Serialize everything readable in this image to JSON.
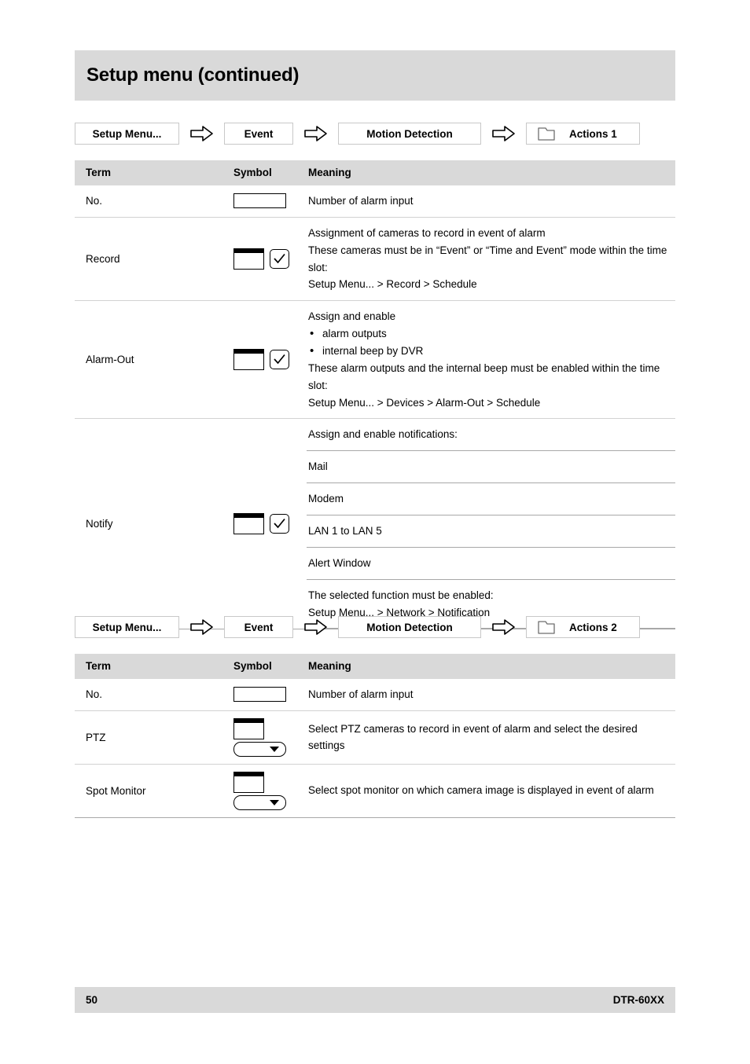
{
  "header": {
    "title": "Setup menu (continued)"
  },
  "breadcrumbs": [
    {
      "name": "actions-1",
      "items": [
        "Setup Menu...",
        "Event",
        "Motion Detection",
        "Actions 1"
      ],
      "arrow_icon": "right-arrow-icon",
      "folder_icon": "folder-tab-icon"
    },
    {
      "name": "actions-2",
      "items": [
        "Setup Menu...",
        "Event",
        "Motion Detection",
        "Actions 2"
      ],
      "arrow_icon": "right-arrow-icon",
      "folder_icon": "folder-tab-icon"
    }
  ],
  "table1": {
    "headers": [
      "Term",
      "Symbol",
      "Meaning"
    ],
    "rows": [
      {
        "term": "No.",
        "symbols": [
          "text-field-icon"
        ],
        "meaning_lines": [
          "Number of alarm input"
        ]
      },
      {
        "term": "Record",
        "symbols": [
          "window-icon",
          "checkbox-checked-icon"
        ],
        "meaning_lines": [
          "Assignment of cameras to record in event of alarm",
          "These cameras must be in “Event” or “Time and Event” mode within the time slot:",
          "Setup Menu... > Record > Schedule"
        ]
      },
      {
        "term": "Alarm-Out",
        "symbols": [
          "window-icon",
          "checkbox-checked-icon"
        ],
        "meaning_lines": [
          "Assign and enable"
        ],
        "bullets": [
          "alarm outputs",
          "internal beep by DVR"
        ],
        "meaning_lines_after": [
          "These alarm outputs and the internal beep must be enabled within the time slot:",
          "Setup Menu... > Devices > Alarm-Out > Schedule"
        ]
      },
      {
        "term": "Notify",
        "symbols": [
          "window-icon",
          "checkbox-checked-icon"
        ],
        "sub_rows": [
          {
            "lines": [
              "Assign and enable notifications:"
            ]
          },
          {
            "lines": [
              "Mail"
            ]
          },
          {
            "lines": [
              "Modem"
            ]
          },
          {
            "lines": [
              "LAN 1 to LAN 5"
            ]
          },
          {
            "lines": [
              "Alert Window"
            ]
          },
          {
            "lines": [
              "The selected function must be enabled:",
              "Setup Menu... > Network > Notification"
            ]
          }
        ]
      }
    ]
  },
  "table2": {
    "headers": [
      "Term",
      "Symbol",
      "Meaning"
    ],
    "rows": [
      {
        "term": "No.",
        "symbols": [
          "text-field-icon"
        ],
        "meaning_lines": [
          "Number of alarm input"
        ]
      },
      {
        "term": "PTZ",
        "symbols": [
          "window-icon",
          "dropdown-icon"
        ],
        "meaning_lines": [
          "Select PTZ cameras to record in event of alarm and select the desired settings"
        ]
      },
      {
        "term": "Spot Monitor",
        "symbols": [
          "window-icon",
          "dropdown-icon"
        ],
        "meaning_lines": [
          "Select spot monitor on which camera image is displayed in event of alarm"
        ]
      }
    ]
  },
  "footer": {
    "page_number": "50",
    "model": "DTR-60XX"
  },
  "colors": {
    "banner": "#d9d9d9",
    "rule": "#d2d2d2"
  }
}
